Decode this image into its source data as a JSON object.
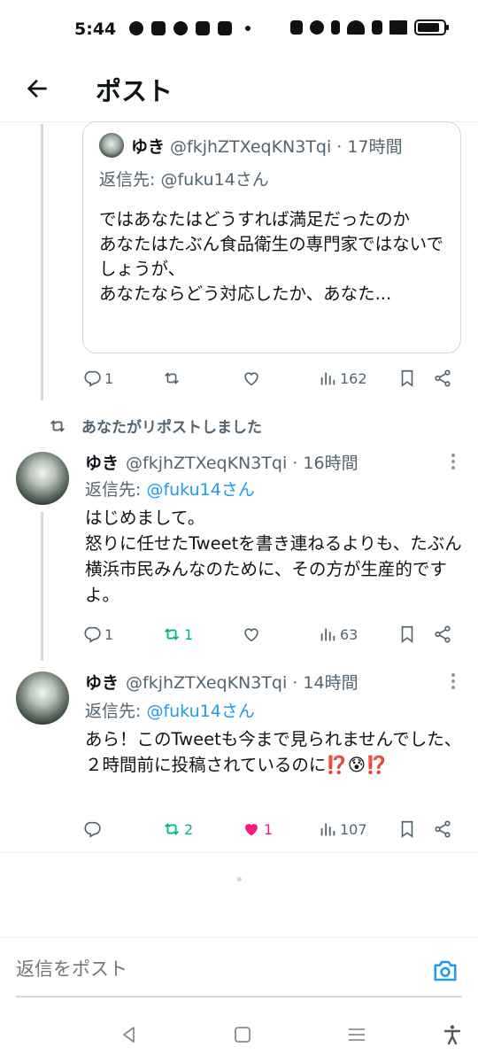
{
  "status_bar": {
    "time": "5:44"
  },
  "header": {
    "title": "ポスト"
  },
  "quoted": {
    "name": "ゆき",
    "handle": "@fkjhZTXeqKN3Tqi · 17時間",
    "reply_to": "返信先: @fuku14さん",
    "text": "ではあなたはどうすれば満足だったのか\nあなたはたぶん食品衛生の専門家ではないでしょうが、\nあなたならどう対応したか、あなた...",
    "actions": {
      "replies": "1",
      "reposts": "",
      "likes": "",
      "views": "162"
    }
  },
  "repost_label": "あなたがリポストしました",
  "tweets": [
    {
      "name": "ゆき",
      "handle": "@fkjhZTXeqKN3Tqi · 16時間",
      "reply_prefix": "返信先: ",
      "reply_user": "@fuku14さん",
      "text": "はじめまして。\n怒りに任せたTweetを書き連ねるよりも、たぶん横浜市民みんなのために、その方が生産的ですよ。",
      "actions": {
        "replies": "1",
        "reposts": "1",
        "likes": "",
        "views": "63"
      }
    },
    {
      "name": "ゆき",
      "handle": "@fkjhZTXeqKN3Tqi · 14時間",
      "reply_prefix": "返信先: ",
      "reply_user": "@fuku14さん",
      "text": "あら！このTweetも今まで見られませんでした、\n２時間前に投稿されているのに⁉️😰⁉️",
      "actions": {
        "replies": "",
        "reposts": "2",
        "likes": "1",
        "views": "107"
      }
    }
  ],
  "reply_bar": {
    "placeholder": "返信をポスト"
  },
  "colors": {
    "accent": "#1d9bf0",
    "repost": "#00ba7c",
    "like": "#f91880",
    "muted": "#536471"
  }
}
